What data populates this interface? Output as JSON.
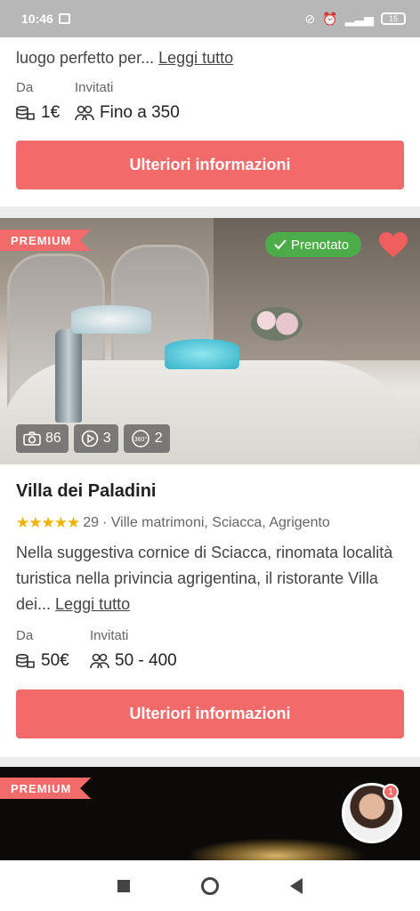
{
  "status_bar": {
    "time": "10:46",
    "battery": "15"
  },
  "listing_1": {
    "description_tail": "luogo perfetto per...",
    "read_more": "Leggi tutto",
    "price_label": "Da",
    "price_value": "1€",
    "guests_label": "Invitati",
    "guests_value": "Fino a 350",
    "cta": "Ulteriori informazioni"
  },
  "listing_2": {
    "badge": "PREMIUM",
    "booked_label": "Prenotato",
    "photos_count": "86",
    "videos_count": "3",
    "tours_count": "2",
    "tour_icon_text": "360°",
    "title": "Villa dei Paladini",
    "stars": "★★★★★",
    "reviews_count": "29",
    "category_location": "· Ville matrimoni, Sciacca, Agrigento",
    "description": "Nella suggestiva cornice di Sciacca, rinomata località turistica nella privincia agrigentina, il ristorante Villa dei...",
    "read_more": "Leggi tutto",
    "price_label": "Da",
    "price_value": "50€",
    "guests_label": "Invitati",
    "guests_value": "50 - 400",
    "cta": "Ulteriori informazioni"
  },
  "listing_3": {
    "badge": "PREMIUM"
  },
  "chat": {
    "notification_count": "1"
  },
  "colors": {
    "accent": "#f26a6a",
    "booked": "#4cac4a",
    "star": "#f0b400"
  }
}
